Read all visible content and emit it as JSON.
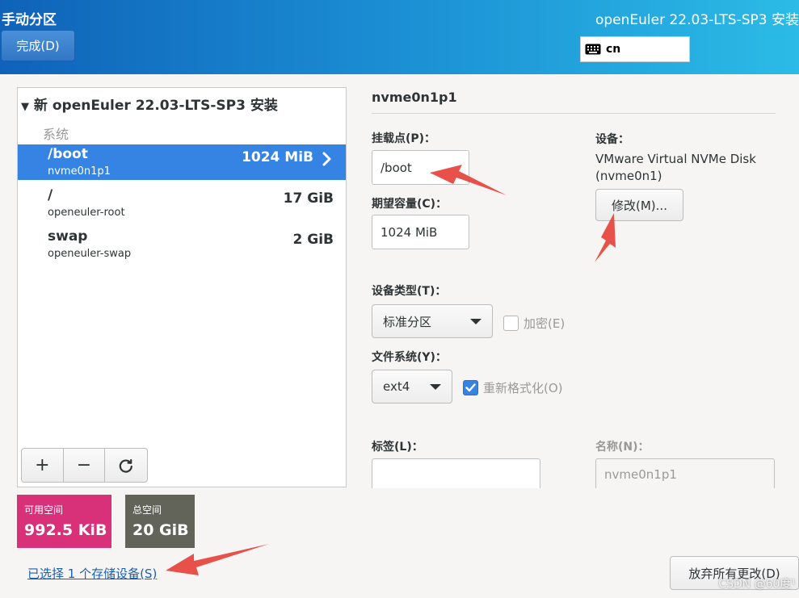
{
  "header": {
    "title": "手动分区",
    "done_label": "完成(D)",
    "product": "openEuler 22.03-LTS-SP3 安装",
    "keyboard_layout": "cn"
  },
  "install_tree": {
    "header": "新 openEuler 22.03-LTS-SP3 安装",
    "group_label": "系统",
    "partitions": [
      {
        "mount": "/boot",
        "device": "nvme0n1p1",
        "size": "1024 MiB",
        "selected": true
      },
      {
        "mount": "/",
        "device": "openeuler-root",
        "size": "17 GiB",
        "selected": false
      },
      {
        "mount": "swap",
        "device": "openeuler-swap",
        "size": "2 GiB",
        "selected": false
      }
    ]
  },
  "toolbar": {
    "add": "+",
    "remove": "−"
  },
  "space": {
    "available_label": "可用空间",
    "available_value": "992.5 KiB",
    "total_label": "总空间",
    "total_value": "20 GiB"
  },
  "storage_link": "已选择 1 个存储设备(S)",
  "detail": {
    "title": "nvme0n1p1",
    "mount_label": "挂载点(P)：",
    "mount_value": "/boot",
    "capacity_label": "期望容量(C)：",
    "capacity_value": "1024 MiB",
    "device_label": "设备：",
    "device_name": "VMware Virtual NVMe Disk",
    "device_id": "(nvme0n1)",
    "modify_label": "修改(M)...",
    "device_type_label": "设备类型(T)：",
    "device_type_value": "标准分区",
    "encrypt_label": "加密(E)",
    "filesystem_label": "文件系统(Y)：",
    "filesystem_value": "ext4",
    "reformat_label": "重新格式化(O)",
    "tag_label": "标签(L)：",
    "tag_value": "",
    "name_label": "名称(N)：",
    "name_value": "nvme0n1p1"
  },
  "discard_label": "放弃所有更改(D)",
  "watermark": "CSDN @60度¹",
  "colors": {
    "selected": "#3584e4",
    "available": "#d9307a",
    "total": "#636459",
    "annotation_arrow": "#e8504a"
  }
}
